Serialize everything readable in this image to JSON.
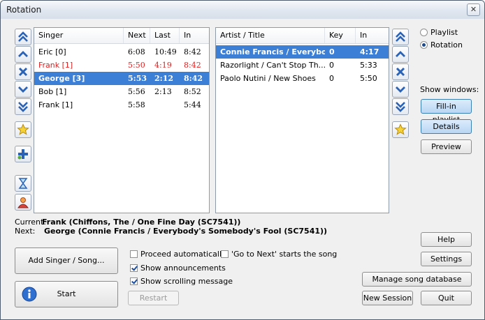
{
  "window": {
    "title": "Rotation",
    "close_glyph": "✕"
  },
  "singers": {
    "columns": [
      "Singer",
      "Next",
      "Last",
      "In"
    ],
    "rows": [
      {
        "singer": "Eric [0]",
        "next": "6:08",
        "last": "10:49",
        "in": "8:42",
        "state": "normal"
      },
      {
        "singer": "Frank [1]",
        "next": "5:50",
        "last": "4:19",
        "in": "8:42",
        "state": "current"
      },
      {
        "singer": "George [3]",
        "next": "5:53",
        "last": "2:12",
        "in": "8:42",
        "state": "selected"
      },
      {
        "singer": "Bob  [1]",
        "next": "5:56",
        "last": "2:13",
        "in": "8:52",
        "state": "normal"
      },
      {
        "singer": "Frank  [1]",
        "next": "5:58",
        "last": "",
        "in": "5:44",
        "state": "normal"
      }
    ]
  },
  "songs": {
    "columns": [
      "Artist / Title",
      "Key",
      "In"
    ],
    "rows": [
      {
        "title": "Connie Francis / Everybod...",
        "key": "0",
        "in": "4:17",
        "state": "selected"
      },
      {
        "title": "Razorlight / Can't Stop Th...",
        "key": "0",
        "in": "5:33",
        "state": "normal"
      },
      {
        "title": "Paolo Nutini / New Shoes",
        "key": "0",
        "in": "5:50",
        "state": "normal"
      }
    ]
  },
  "mode": {
    "options": [
      "Playlist",
      "Rotation"
    ],
    "selected": "Rotation"
  },
  "show_windows": {
    "label": "Show windows:",
    "fill_in": "Fill-in playlist",
    "details": "Details",
    "preview": "Preview"
  },
  "status": {
    "current_label": "Current:",
    "current_value": "Frank (Chiffons, The / One Fine Day (SC7541))",
    "next_label": "Next:",
    "next_value": "George (Connie Francis / Everybody's Somebody's Fool (SC7541))"
  },
  "buttons": {
    "add": "Add Singer / Song...",
    "start": "Start",
    "restart": "Restart",
    "help": "Help",
    "settings": "Settings",
    "manage": "Manage song database",
    "new_session": "New Session",
    "quit": "Quit"
  },
  "options": {
    "proceed": {
      "label": "Proceed automatically",
      "checked": false
    },
    "go_next": {
      "label": "'Go to Next' starts the song",
      "checked": false
    },
    "announcements": {
      "label": "Show announcements",
      "checked": true
    },
    "scrolling": {
      "label": "Show scrolling message",
      "checked": true
    }
  },
  "colors": {
    "accent": "#3b7fd7",
    "highlight": "#e02020"
  }
}
